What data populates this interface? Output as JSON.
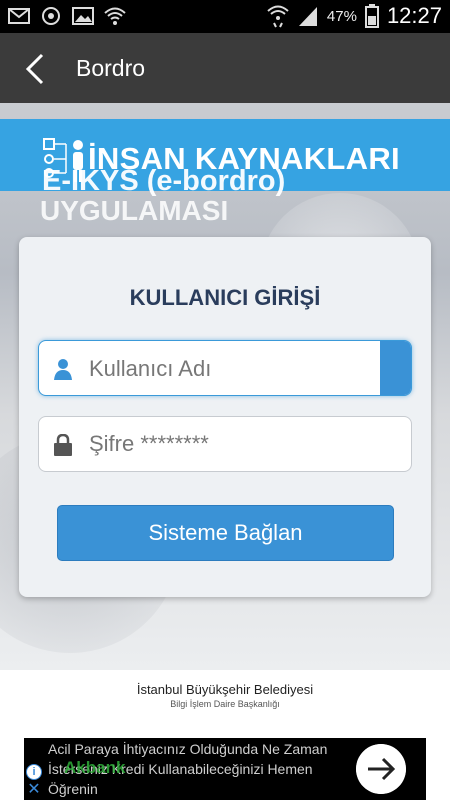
{
  "status_bar": {
    "battery_percent": "47%",
    "time": "12:27",
    "icons": [
      "mail-icon",
      "sync-icon",
      "image-icon",
      "wifi-icon",
      "wifi-transfer-icon",
      "signal-icon",
      "battery-icon"
    ]
  },
  "action_bar": {
    "title": "Bordro",
    "back_icon": "chevron-left-icon"
  },
  "banner": {
    "title": "İNSAN KAYNAKLARI",
    "subtitle_line1": "E-IKYS (e-bordro)",
    "subtitle_line2": "UYGULAMASI",
    "icon": "org-chart-icon"
  },
  "login": {
    "title": "KULLANICI GİRİŞİ",
    "username_placeholder": "Kullanıcı Adı",
    "password_placeholder": "Şifre ********",
    "submit_label": "Sisteme Bağlan",
    "user_icon": "user-icon",
    "lock_icon": "lock-icon",
    "accent_color": "#3a92d6"
  },
  "footer": {
    "line1": "İstanbul Büyükşehir Belediyesi",
    "line2": "Bilgi İşlem Daire Başkanlığı"
  },
  "ad": {
    "text": "Acil Paraya İhtiyacınız Olduğunda Ne Zaman İsterseniz Kredi Kullanabileceğinizi Hemen Öğrenin",
    "brand": "Akbank",
    "arrow_icon": "arrow-right-icon",
    "info_icon": "info-icon",
    "close_icon": "close-icon"
  }
}
